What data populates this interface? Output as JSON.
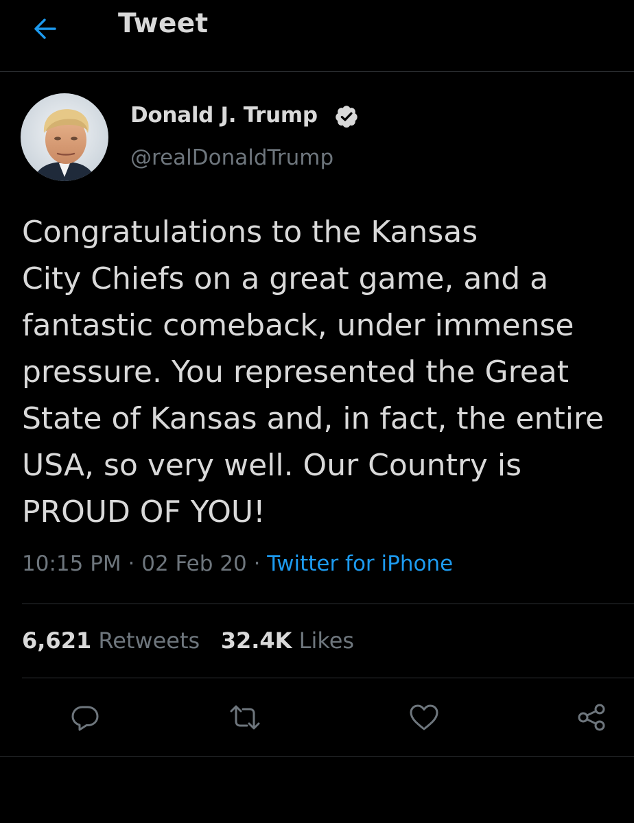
{
  "header": {
    "title": "Tweet",
    "back_icon": "arrow-left-icon",
    "accent_color": "#1d9bf0"
  },
  "author": {
    "display_name": "Donald J. Trump",
    "handle": "@realDonaldTrump",
    "verified_icon": "verified-badge-icon"
  },
  "tweet": {
    "lines": [
      "Congratulations to the Kansas",
      "City Chiefs on a great game, and a",
      "fantastic comeback, under immense",
      "pressure. You represented the Great",
      "State of Kansas and, in fact, the entire",
      "USA, so very well. Our Country is",
      "PROUD OF YOU!"
    ],
    "time": "10:15 PM",
    "separator": "·",
    "date": "02 Feb 20",
    "source": "Twitter for iPhone"
  },
  "stats": {
    "retweets_count": "6,621",
    "retweets_label": "Retweets",
    "likes_count": "32.4K",
    "likes_label": "Likes"
  },
  "actions": [
    {
      "icon": "reply-icon"
    },
    {
      "icon": "retweet-icon"
    },
    {
      "icon": "like-icon"
    },
    {
      "icon": "share-icon"
    }
  ]
}
